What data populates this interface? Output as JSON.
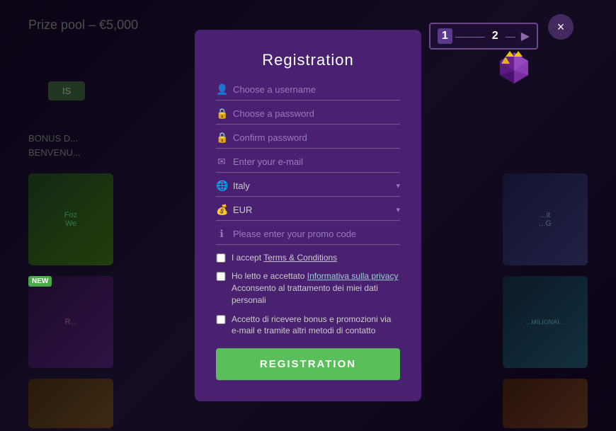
{
  "modal": {
    "title": "Registration",
    "close_label": "×",
    "fields": {
      "username_placeholder": "Choose a username",
      "password_placeholder": "Choose a password",
      "confirm_password_placeholder": "Confirm password",
      "email_placeholder": "Enter your e-mail",
      "country_default": "Italy",
      "currency_default": "EUR",
      "promo_placeholder": "Please enter your promo code"
    },
    "checkboxes": {
      "terms_label": "I accept ",
      "terms_link": "Terms & Conditions",
      "privacy_line1": "Ho letto e accettato ",
      "privacy_link": "Informativa sulla privacy",
      "privacy_line2": "Acconsento al trattamento dei miei dati personali",
      "marketing_label": "Accetto di ricevere bonus e promozioni via e-mail e tramite altri metodi di contatto"
    },
    "register_button": "REGISTRATION"
  },
  "steps": {
    "step1": "1",
    "step2": "2",
    "step_play_icon": "▶"
  },
  "background": {
    "prize_text": "Prize pool – €5,000",
    "bonus_line1": "BONUS D...",
    "bonus_line2": "BENVENU...",
    "is_button": "IS",
    "new_badge": "NEW",
    "milionario_text": "MILIONARIO"
  },
  "icons": {
    "user": "👤",
    "lock": "🔒",
    "email": "✉",
    "globe": "🌐",
    "coin": "💰",
    "info": "ℹ",
    "chevron_down": "▾"
  }
}
